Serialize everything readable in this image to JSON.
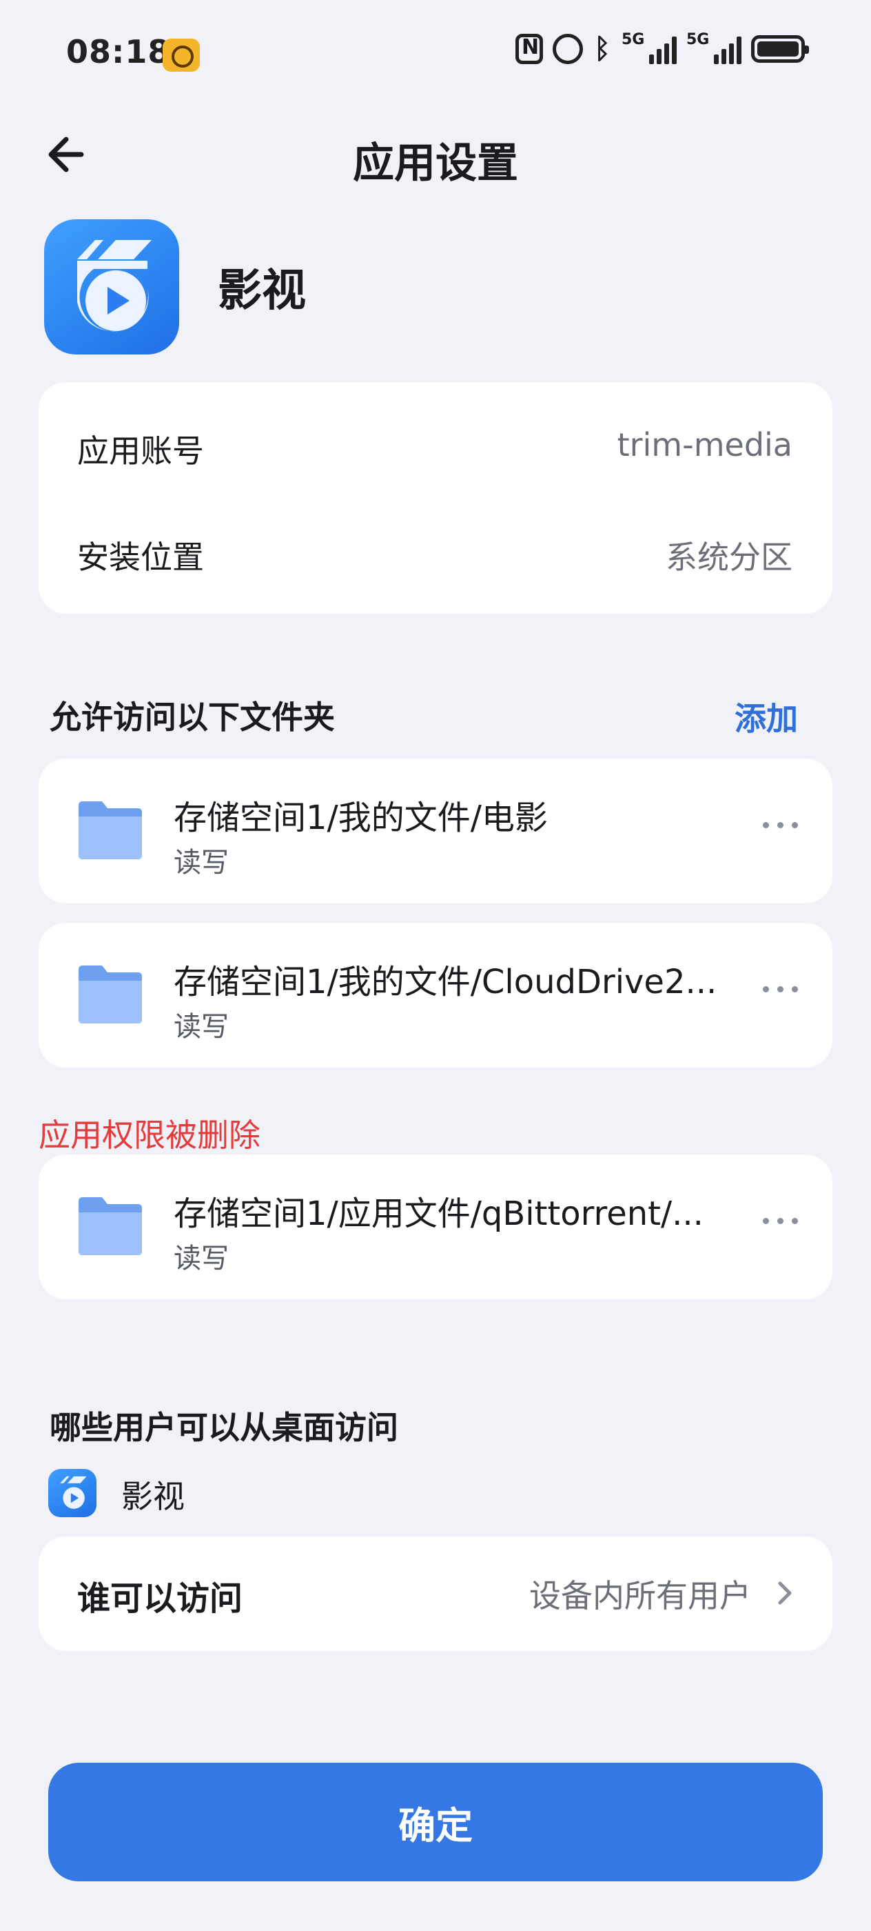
{
  "status_bar": {
    "time": "08:18",
    "signal_labels": [
      "5G",
      "5G"
    ],
    "icons": [
      "notification-app-icon",
      "nfc-icon",
      "alarm-icon",
      "bluetooth-icon",
      "signal-icon",
      "signal-icon",
      "battery-icon"
    ]
  },
  "header": {
    "title": "应用设置"
  },
  "app": {
    "name": "影视"
  },
  "info": {
    "account_label": "应用账号",
    "account_value": "trim-media",
    "location_label": "安装位置",
    "location_value": "系统分区"
  },
  "folders_section": {
    "title": "允许访问以下文件夹",
    "add_label": "添加",
    "items": [
      {
        "path": "存储空间1/我的文件/电影",
        "permission": "读写"
      },
      {
        "path": "存储空间1/我的文件/CloudDrive2...",
        "permission": "读写"
      }
    ]
  },
  "removed_section": {
    "warning": "应用权限被删除",
    "items": [
      {
        "path": "存储空间1/应用文件/qBittorrent/...",
        "permission": "读写"
      }
    ]
  },
  "users_section": {
    "title": "哪些用户可以从桌面访问",
    "app_name": "影视",
    "access_label": "谁可以访问",
    "access_value": "设备内所有用户"
  },
  "confirm_label": "确定",
  "colors": {
    "accent": "#3577e4",
    "warning": "#e43c3c",
    "background": "#f1f2f7"
  }
}
